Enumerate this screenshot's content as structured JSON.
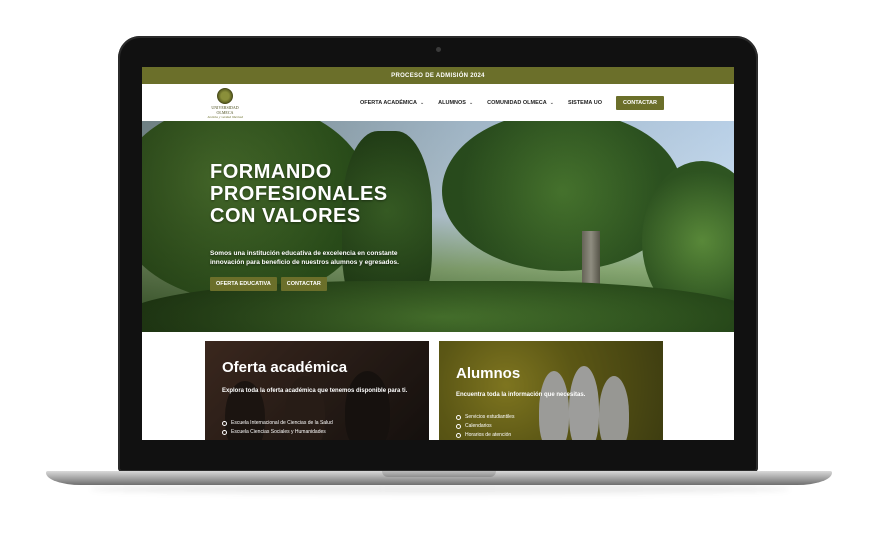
{
  "banner": {
    "text": "PROCESO DE ADMISIÓN 2024"
  },
  "brand": {
    "name": "UNIVERSIDAD OLMECA",
    "motto": "Justicia y verdad libertad"
  },
  "nav": {
    "items": [
      {
        "label": "OFERTA ACADÉMICA",
        "has_dropdown": true
      },
      {
        "label": "ALUMNOS",
        "has_dropdown": true
      },
      {
        "label": "COMUNIDAD OLMECA",
        "has_dropdown": true
      },
      {
        "label": "SISTEMA UO",
        "has_dropdown": false
      }
    ],
    "cta_label": "CONTACTAR"
  },
  "hero": {
    "title_lines": [
      "FORMANDO",
      "PROFESIONALES",
      "CON VALORES"
    ],
    "subtitle": "Somos una institución educativa de excelencia en constante innovación para beneficio de nuestros alumnos y egresados.",
    "buttons": [
      "OFERTA EDUCATIVA",
      "CONTACTAR"
    ]
  },
  "cards": [
    {
      "title": "Oferta académica",
      "description": "Explora toda la oferta académica que tenemos disponible para ti.",
      "items": [
        "Escuela Internacional de Ciencias de la Salud",
        "Escuela Ciencias Sociales y Humanidades"
      ]
    },
    {
      "title": "Alumnos",
      "description": "Encuentra toda la información que necesitas.",
      "items": [
        "Servicios estudiantiles",
        "Calendarios",
        "Horarios de atención"
      ]
    }
  ],
  "colors": {
    "brand": "#6b6f2a",
    "text": "#222222",
    "laptop_bezel": "#111111"
  },
  "icons": {
    "dropdown": "chevron-down-icon",
    "list_bullet": "check-circle-icon"
  }
}
